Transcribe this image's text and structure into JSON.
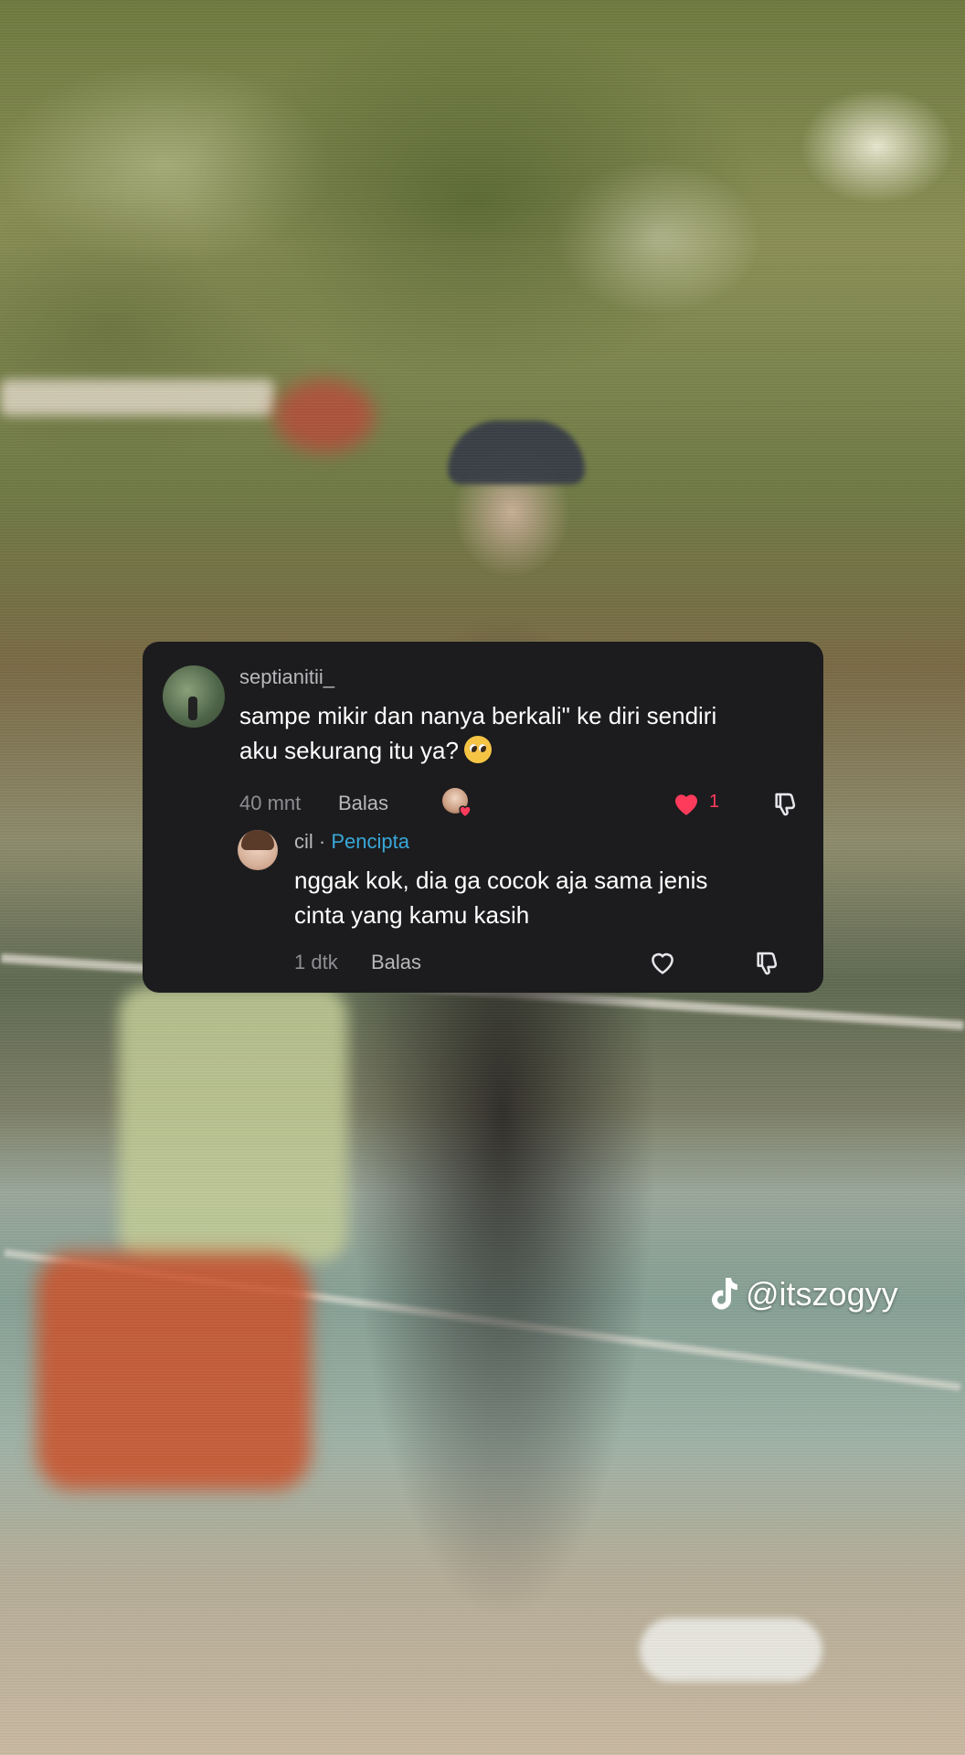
{
  "background": {
    "description_colors": {
      "foliage": "#6e7a3f",
      "court": "#86a095",
      "pants": "#cd5028"
    }
  },
  "comment_card": {
    "main_comment": {
      "avatar_icon": "user-avatar",
      "username": "septianitii_",
      "text_line1": "sampe mikir dan nanya berkali\" ke diri sendiri",
      "text_line2": "aku sekurang itu ya?",
      "emoji": "pleading-face-emoji",
      "time": "40 mnt",
      "reply_label": "Balas",
      "creator_liked_icon": "creator-liked-icon",
      "like_count": "1",
      "liked": true,
      "like_color": "#ff3b5c"
    },
    "reply_comment": {
      "avatar_icon": "creator-avatar",
      "username": "cil",
      "separator": " · ",
      "creator_badge": "Pencipta",
      "text_line1": "nggak kok, dia ga cocok aja sama jenis",
      "text_line2": "cinta yang kamu kasih",
      "time": "1 dtk",
      "reply_label": "Balas",
      "liked": false
    },
    "background_color": "#1c1c1e",
    "accent_color": "#39a7d8"
  },
  "watermark": {
    "icon": "tiktok-logo-icon",
    "handle": "@itszogyy"
  }
}
